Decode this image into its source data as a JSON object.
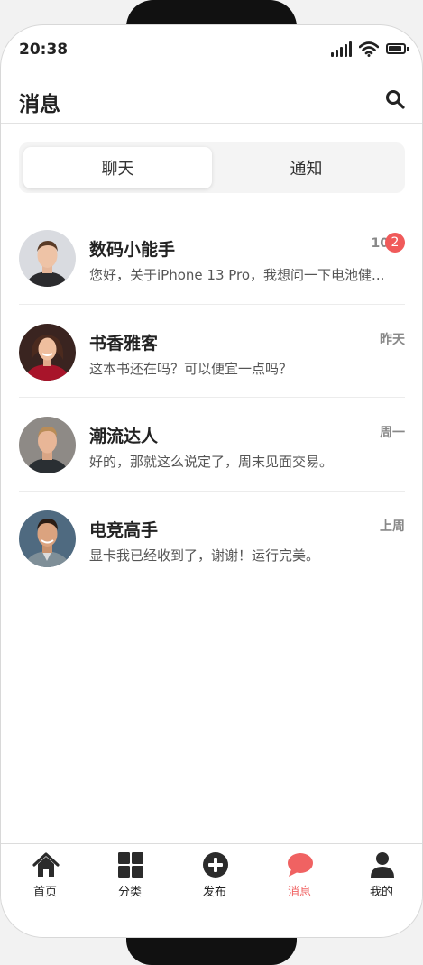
{
  "status": {
    "time": "20:38"
  },
  "header": {
    "title": "消息"
  },
  "tabs": [
    {
      "label": "聊天",
      "active": true
    },
    {
      "label": "通知",
      "active": false
    }
  ],
  "chats": [
    {
      "name": "数码小能手",
      "message": "您好，关于iPhone 13 Pro，我想问一下电池健...",
      "time": "10",
      "unread": "2"
    },
    {
      "name": "书香雅客",
      "message": "这本书还在吗？可以便宜一点吗？",
      "time": "昨天",
      "unread": ""
    },
    {
      "name": "潮流达人",
      "message": "好的，那就这么说定了，周末见面交易。",
      "time": "周一",
      "unread": ""
    },
    {
      "name": "电竞高手",
      "message": "显卡我已经收到了，谢谢！运行完美。",
      "time": "上周",
      "unread": ""
    }
  ],
  "nav": [
    {
      "label": "首页",
      "icon": "home-icon",
      "active": false
    },
    {
      "label": "分类",
      "icon": "grid-icon",
      "active": false
    },
    {
      "label": "发布",
      "icon": "plus-circle-icon",
      "active": false
    },
    {
      "label": "消息",
      "icon": "chat-bubble-icon",
      "active": true
    },
    {
      "label": "我的",
      "icon": "user-icon",
      "active": false
    }
  ],
  "colors": {
    "accent": "#f06262",
    "badge": "#f05a5a",
    "text": "#222222"
  }
}
